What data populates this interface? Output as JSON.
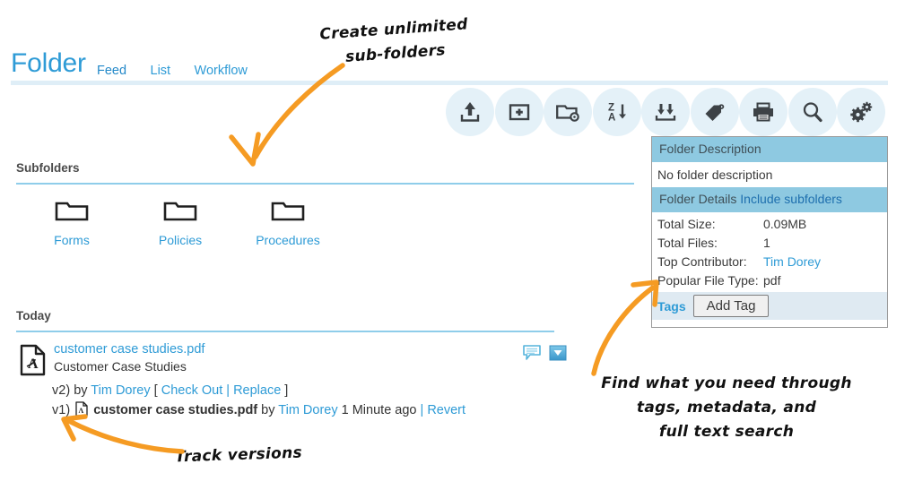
{
  "header": {
    "title": "Folder",
    "tabs": [
      {
        "label": "Feed",
        "active": true
      },
      {
        "label": "List",
        "active": false
      },
      {
        "label": "Workflow",
        "active": false
      }
    ]
  },
  "toolbar": {
    "buttons": [
      {
        "icon": "upload-icon",
        "name": "upload-button"
      },
      {
        "icon": "new-document-icon",
        "name": "new-document-button"
      },
      {
        "icon": "new-folder-icon",
        "name": "new-folder-button"
      },
      {
        "icon": "sort-za-icon",
        "name": "sort-button"
      },
      {
        "icon": "download-icon",
        "name": "download-button"
      },
      {
        "icon": "tag-icon",
        "name": "tag-button"
      },
      {
        "icon": "print-icon",
        "name": "print-button"
      },
      {
        "icon": "search-icon",
        "name": "search-button"
      },
      {
        "icon": "settings-gears-icon",
        "name": "settings-button"
      }
    ]
  },
  "subfolders": {
    "heading": "Subfolders",
    "items": [
      {
        "label": "Forms"
      },
      {
        "label": "Policies"
      },
      {
        "label": "Procedures"
      }
    ]
  },
  "feed": {
    "heading": "Today",
    "file": {
      "name": "customer case studies.pdf",
      "description": "Customer Case Studies",
      "icon": "pdf-file-icon"
    },
    "actions": [
      {
        "icon": "comment-icon",
        "name": "comment-button"
      },
      {
        "icon": "download-dropdown-icon",
        "name": "download-dropdown-button"
      }
    ],
    "versions": [
      {
        "version": "v2)",
        "by_label": "by",
        "author": "Tim Dorey",
        "open_bracket": "[",
        "actions": [
          "Check Out",
          "Replace"
        ],
        "separator": "|",
        "close_bracket": "]"
      },
      {
        "version": "v1)",
        "filename": "customer case studies.pdf",
        "by_label": "by",
        "author": "Tim Dorey",
        "time": "1 Minute ago",
        "separator": "|",
        "action": "Revert",
        "icon": "pdf-small-icon"
      }
    ]
  },
  "info_panel": {
    "description_header": "Folder Description",
    "description_text": "No folder description",
    "details_header": "Folder Details",
    "details_link": "Include subfolders",
    "details": [
      {
        "key": "Total Size:",
        "value": "0.09MB",
        "is_link": false
      },
      {
        "key": "Total Files:",
        "value": "1",
        "is_link": false
      },
      {
        "key": "Top Contributor:",
        "value": "Tim Dorey",
        "is_link": true
      },
      {
        "key": "Popular File Type:",
        "value": "pdf",
        "is_link": false
      }
    ],
    "tags_label": "Tags",
    "add_tag_label": "Add Tag"
  },
  "annotations": [
    {
      "id": "anno-subfolders",
      "line1": "Create unlimited",
      "line2": "sub-folders"
    },
    {
      "id": "anno-track",
      "line1": "Track versions"
    },
    {
      "id": "anno-find",
      "line1": "Find what you need through",
      "line2": "tags, metadata, and",
      "line3": "full text search"
    }
  ],
  "colors": {
    "accent_blue": "#2e9bd6",
    "tab_active_blue": "#2489c9",
    "panel_header_blue": "#8ec9e1",
    "tool_circle_blue": "#e4f1f8",
    "rule_blue": "#8fcdea",
    "annotation_orange": "#f59b23",
    "tags_row_bg": "#dfeaf2"
  }
}
